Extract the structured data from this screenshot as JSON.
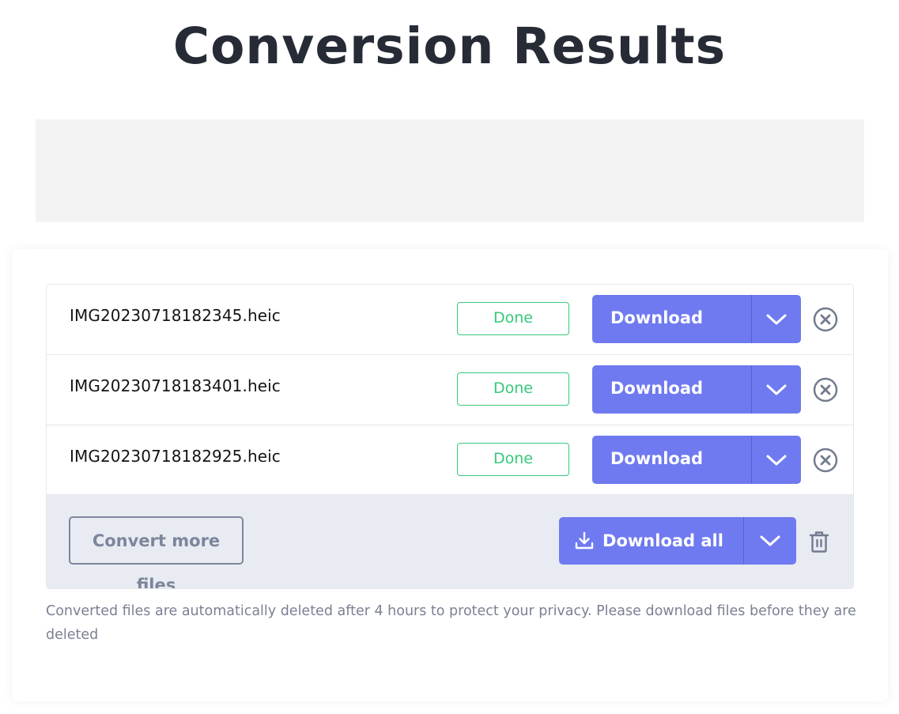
{
  "page": {
    "title": "Conversion Results"
  },
  "colors": {
    "accent": "#6f7af0",
    "success": "#35c97a",
    "muted": "#7d869b",
    "footer_bg": "#e8ebf2",
    "title": "#262b36"
  },
  "files": [
    {
      "name": "IMG20230718182345.heic",
      "status": "Done",
      "download_label": "Download",
      "caret_icon": "chevron-down-icon",
      "remove_icon": "close-circle-icon"
    },
    {
      "name": "IMG20230718183401.heic",
      "status": "Done",
      "download_label": "Download",
      "caret_icon": "chevron-down-icon",
      "remove_icon": "close-circle-icon"
    },
    {
      "name": "IMG20230718182925.heic",
      "status": "Done",
      "download_label": "Download",
      "caret_icon": "chevron-down-icon",
      "remove_icon": "close-circle-icon"
    }
  ],
  "footer": {
    "convert_more_label": "Convert more files",
    "download_all_label": "Download all",
    "download_all_icon": "download-icon",
    "caret_icon": "chevron-down-icon",
    "trash_icon": "trash-icon"
  },
  "note": "Converted files are automatically deleted after 4 hours to protect your privacy. Please download files before they are deleted"
}
